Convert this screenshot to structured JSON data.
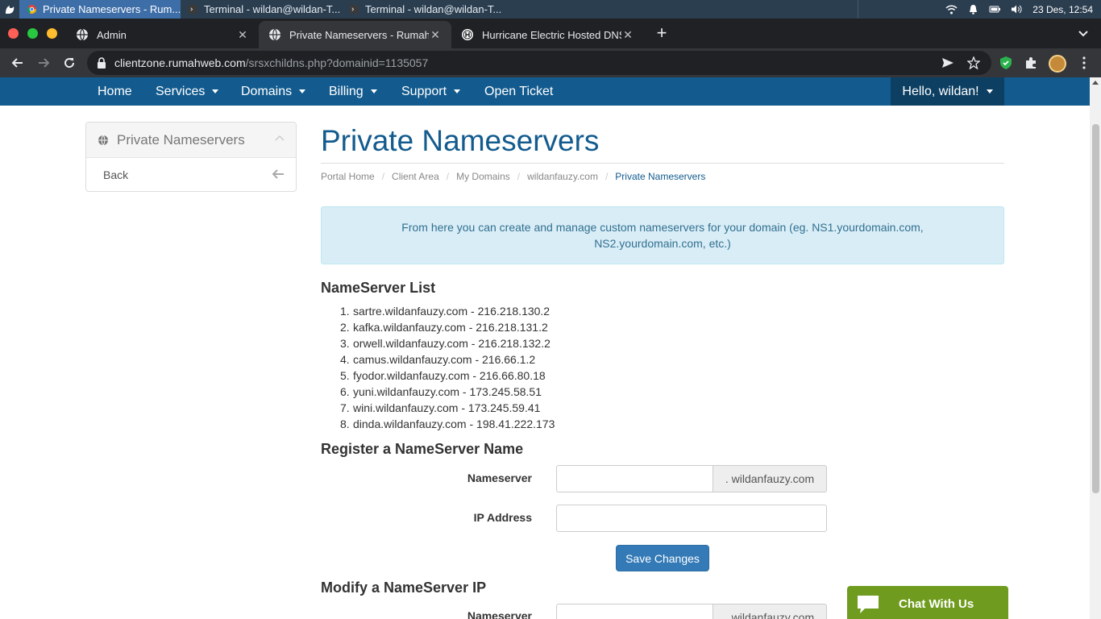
{
  "taskbar": {
    "tasks": [
      {
        "label": "Private Nameservers - Rum...",
        "active": true
      },
      {
        "label": "Terminal - wildan@wildan-T...",
        "active": false
      },
      {
        "label": "Terminal - wildan@wildan-T...",
        "active": false
      }
    ],
    "clock": "23 Des, 12:54"
  },
  "browser": {
    "tabs": [
      {
        "title": "Admin",
        "icon": "globe-icon"
      },
      {
        "title": "Private Nameservers - Rumahweb",
        "icon": "globe-icon",
        "active": true
      },
      {
        "title": "Hurricane Electric Hosted DNS",
        "icon": "he-icon"
      }
    ],
    "url_host": "clientzone.rumahweb.com",
    "url_path": "/srsxchildns.php?domainid=1135057"
  },
  "nav": {
    "items": [
      "Home",
      "Services",
      "Domains",
      "Billing",
      "Support",
      "Open Ticket"
    ],
    "user": "Hello, wildan!"
  },
  "sidebar": {
    "title": "Private Nameservers",
    "back": "Back"
  },
  "main": {
    "title": "Private Nameservers",
    "breadcrumb": [
      "Portal Home",
      "Client Area",
      "My Domains",
      "wildanfauzy.com",
      "Private Nameservers"
    ],
    "alert": "From here you can create and manage custom nameservers for your domain (eg. NS1.yourdomain.com, NS2.yourdomain.com, etc.)",
    "list_heading": "NameServer List",
    "nameservers": [
      "sartre.wildanfauzy.com - 216.218.130.2",
      "kafka.wildanfauzy.com - 216.218.131.2",
      "orwell.wildanfauzy.com - 216.218.132.2",
      "camus.wildanfauzy.com - 216.66.1.2",
      "fyodor.wildanfauzy.com - 216.66.80.18",
      "yuni.wildanfauzy.com - 173.245.58.51",
      "wini.wildanfauzy.com - 173.245.59.41",
      "dinda.wildanfauzy.com - 198.41.222.173"
    ],
    "register_heading": "Register a NameServer Name",
    "nameserver_label": "Nameserver",
    "domain_suffix": ". wildanfauzy.com",
    "ip_label": "IP Address",
    "save_label": "Save Changes",
    "modify_heading": "Modify a NameServer IP"
  },
  "chat": {
    "label": "Chat With Us"
  },
  "colors": {
    "brand": "#135b8e",
    "nav_dark": "#0d3f63",
    "chat": "#6f9c1e",
    "button": "#337ab7"
  }
}
